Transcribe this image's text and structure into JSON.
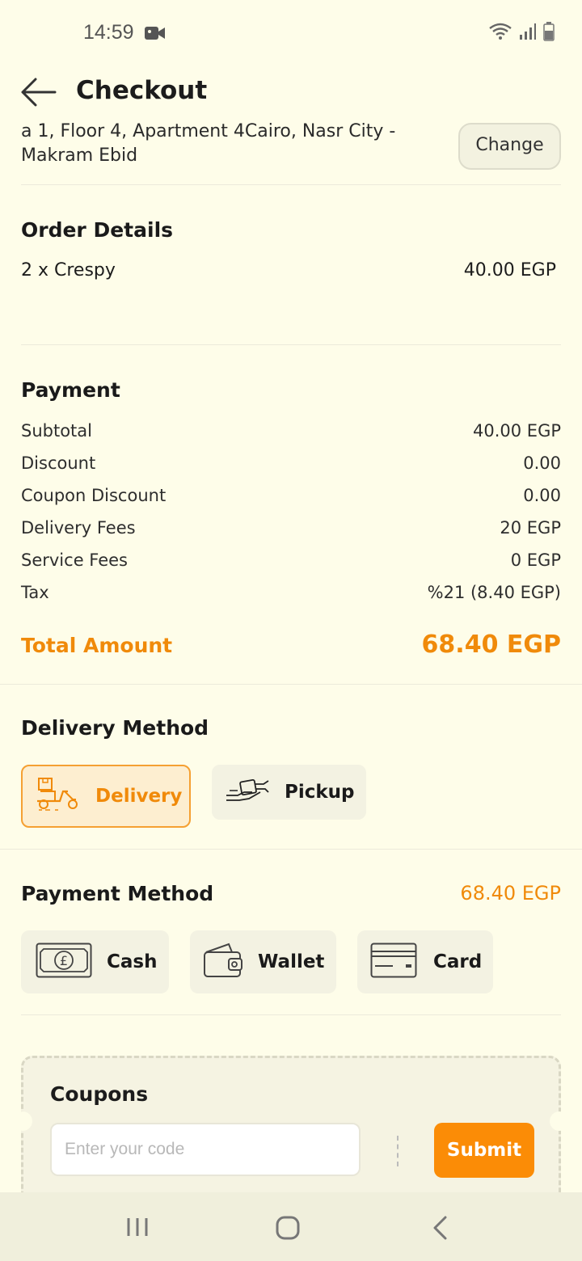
{
  "status": {
    "time": "14:59"
  },
  "header": {
    "title": "Checkout"
  },
  "address": {
    "line1": "a 1, Floor 4, Apartment 4Cairo, Nasr City -",
    "line2": "Makram Ebid",
    "change_label": "Change"
  },
  "order": {
    "title": "Order Details",
    "items": [
      {
        "name": "2 x Crespy",
        "price": "40.00 EGP"
      }
    ]
  },
  "payment": {
    "title": "Payment",
    "rows": [
      {
        "label": "Subtotal",
        "value": "40.00 EGP"
      },
      {
        "label": "Discount",
        "value": "0.00"
      },
      {
        "label": "Coupon Discount",
        "value": "0.00"
      },
      {
        "label": "Delivery Fees",
        "value": "20 EGP"
      },
      {
        "label": "Service Fees",
        "value": "0  EGP"
      },
      {
        "label": "Tax",
        "value": "%21 (8.40  EGP)"
      }
    ],
    "total_label": "Total Amount",
    "total_value": "68.40 EGP"
  },
  "delivery_method": {
    "title": "Delivery Method",
    "options": [
      {
        "label": "Delivery",
        "icon": "delivery-scooter-icon",
        "selected": true
      },
      {
        "label": "Pickup",
        "icon": "pickup-hand-icon",
        "selected": false
      }
    ]
  },
  "payment_method": {
    "title": "Payment Method",
    "amount": "68.40 EGP",
    "options": [
      {
        "label": "Cash",
        "icon": "cash-note-icon"
      },
      {
        "label": "Wallet",
        "icon": "wallet-icon"
      },
      {
        "label": "Card",
        "icon": "credit-card-icon"
      }
    ]
  },
  "coupons": {
    "title": "Coupons",
    "placeholder": "Enter your code",
    "submit_label": "Submit"
  },
  "colors": {
    "accent": "#fb8c06",
    "background": "#fefde9"
  }
}
